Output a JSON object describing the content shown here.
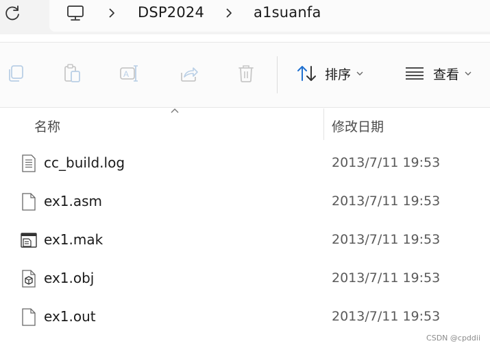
{
  "breadcrumb": {
    "items": [
      "DSP2024",
      "a1suanfa"
    ]
  },
  "toolbar": {
    "sort_label": "排序",
    "view_label": "查看"
  },
  "columns": {
    "name": "名称",
    "date": "修改日期"
  },
  "files": [
    {
      "name": "cc_build.log",
      "date": "2013/7/11 19:53",
      "icon": "text-file-icon"
    },
    {
      "name": "ex1.asm",
      "date": "2013/7/11 19:53",
      "icon": "blank-file-icon"
    },
    {
      "name": "ex1.mak",
      "date": "2013/7/11 19:53",
      "icon": "makefile-icon"
    },
    {
      "name": "ex1.obj",
      "date": "2013/7/11 19:53",
      "icon": "object-file-icon"
    },
    {
      "name": "ex1.out",
      "date": "2013/7/11 19:53",
      "icon": "blank-file-icon"
    }
  ],
  "watermark": "CSDN @cpddii",
  "colors": {
    "accent": "#1e6fd0",
    "toolbar_bg": "#fbfbfb",
    "address_bg": "#f3f3f3",
    "icon_disabled": "#b9cfe6"
  }
}
